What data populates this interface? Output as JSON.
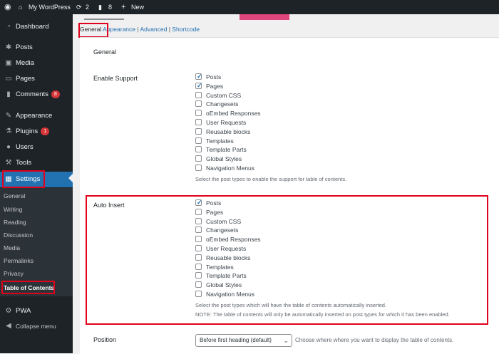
{
  "admin_bar": {
    "site_name": "My WordPress",
    "updates_count": "2",
    "comments_count": "8",
    "new_label": "New"
  },
  "sidebar": {
    "dashboard": "Dashboard",
    "posts": "Posts",
    "media": "Media",
    "pages": "Pages",
    "comments": "Comments",
    "comments_badge": "8",
    "appearance": "Appearance",
    "plugins": "Plugins",
    "plugins_badge": "1",
    "users": "Users",
    "tools": "Tools",
    "settings": "Settings",
    "submenu": [
      "General",
      "Writing",
      "Reading",
      "Discussion",
      "Media",
      "Permalinks",
      "Privacy",
      "Table of Contents"
    ],
    "pwa": "PWA",
    "collapse": "Collapse menu"
  },
  "tabs": {
    "general": "General",
    "appearance": "Appearance",
    "advanced": "Advanced",
    "shortcode": "Shortcode",
    "separator": "|"
  },
  "section_title": "General",
  "enable_support": {
    "label": "Enable Support",
    "options": [
      {
        "label": "Posts",
        "checked": true
      },
      {
        "label": "Pages",
        "checked": true
      },
      {
        "label": "Custom CSS",
        "checked": false
      },
      {
        "label": "Changesets",
        "checked": false
      },
      {
        "label": "oEmbed Responses",
        "checked": false
      },
      {
        "label": "User Requests",
        "checked": false
      },
      {
        "label": "Reusable blocks",
        "checked": false
      },
      {
        "label": "Templates",
        "checked": false
      },
      {
        "label": "Template Parts",
        "checked": false
      },
      {
        "label": "Global Styles",
        "checked": false
      },
      {
        "label": "Navigation Menus",
        "checked": false
      }
    ],
    "description": "Select the post types to enable the support for table of contents."
  },
  "auto_insert": {
    "label": "Auto Insert",
    "options": [
      {
        "label": "Posts",
        "checked": true
      },
      {
        "label": "Pages",
        "checked": false
      },
      {
        "label": "Custom CSS",
        "checked": false
      },
      {
        "label": "Changesets",
        "checked": false
      },
      {
        "label": "oEmbed Responses",
        "checked": false
      },
      {
        "label": "User Requests",
        "checked": false
      },
      {
        "label": "Reusable blocks",
        "checked": false
      },
      {
        "label": "Templates",
        "checked": false
      },
      {
        "label": "Template Parts",
        "checked": false
      },
      {
        "label": "Global Styles",
        "checked": false
      },
      {
        "label": "Navigation Menus",
        "checked": false
      }
    ],
    "description": "Select the post types which will have the table of contents automatically inserted.",
    "note": "NOTE: The table of contents will only be automatically inserted on post types for which it has been enabled."
  },
  "position": {
    "label": "Position",
    "selected": "Before first heading (default)",
    "description": "Choose where where you want to display the table of contents."
  },
  "colors": {
    "admin_dark": "#1d2327",
    "accent_blue": "#2271b1",
    "highlight_red": "#e0001b",
    "badge_red": "#d63638"
  }
}
